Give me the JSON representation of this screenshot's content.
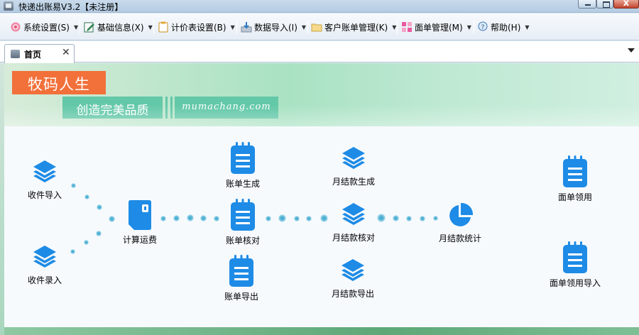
{
  "window": {
    "title": "快递出账易V3.2【未注册】",
    "close_glyph": "x"
  },
  "menu": [
    {
      "label": "系统设置(S)",
      "icon": "gear-icon"
    },
    {
      "label": "基础信息(X)",
      "icon": "edit-icon"
    },
    {
      "label": "计价表设置(B)",
      "icon": "clipboard-icon"
    },
    {
      "label": "数据导入(I)",
      "icon": "import-icon"
    },
    {
      "label": "客户账单管理(K)",
      "icon": "folder-icon"
    },
    {
      "label": "面单管理(M)",
      "icon": "grid-icon"
    },
    {
      "label": "帮助(H)",
      "icon": "help-icon"
    }
  ],
  "tabs": [
    {
      "label": "首页",
      "close_glyph": "✕"
    }
  ],
  "banner": {
    "brand": "牧码人生",
    "slogan": "创造完美品质",
    "domain": "mumachang.com"
  },
  "colors": {
    "brand_orange": "#f2703a",
    "slogan_green": "#63c8a8",
    "icon_blue": "#1e8be6"
  },
  "nodes": {
    "shou_jian_dao_ru": "收件导入",
    "shou_jian_lu_ru": "收件录入",
    "ji_suan_yun_fei": "计算运费",
    "zhang_dan_sheng_cheng": "账单生成",
    "zhang_dan_he_dui": "账单核对",
    "zhang_dan_dao_chu": "账单导出",
    "yue_jie_sheng_cheng": "月结款生成",
    "yue_jie_he_dui": "月结款核对",
    "yue_jie_dao_chu": "月结款导出",
    "yue_jie_tong_ji": "月结款统计",
    "mian_dan_ling_yong": "面单领用",
    "mian_dan_ling_yong_dao_ru": "面单领用导入"
  }
}
